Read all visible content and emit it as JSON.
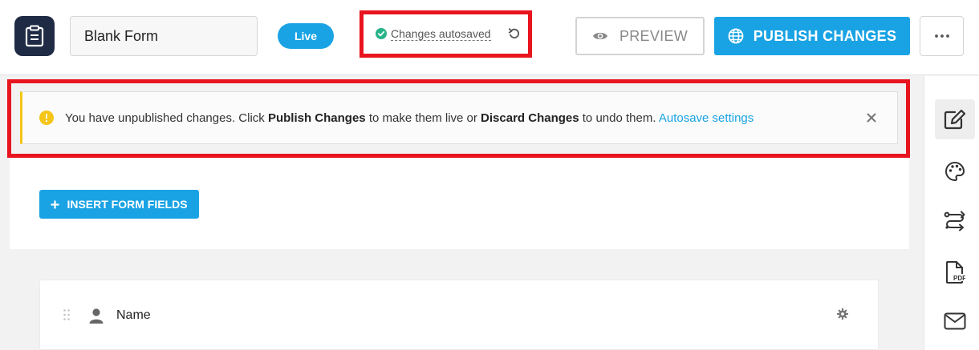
{
  "header": {
    "form_name": "Blank Form",
    "status_badge": "Live",
    "autosave_text": "Changes autosaved",
    "preview_label": "PREVIEW",
    "publish_label": "PUBLISH CHANGES"
  },
  "notice": {
    "text_1": "You have unpublished changes. Click ",
    "publish_bold": "Publish Changes",
    "text_2": " to make them live or ",
    "discard_bold": "Discard Changes",
    "text_3": " to undo them. ",
    "autosave_link": "Autosave settings"
  },
  "canvas": {
    "insert_label": "INSERT FORM FIELDS",
    "fields": [
      {
        "label": "Name",
        "icon": "user-icon"
      }
    ]
  },
  "sidebar": {
    "items": [
      {
        "icon": "edit-icon",
        "active": true
      },
      {
        "icon": "palette-icon",
        "active": false
      },
      {
        "icon": "routing-icon",
        "active": false
      },
      {
        "icon": "pdf-icon",
        "active": false
      },
      {
        "icon": "mail-icon",
        "active": false
      }
    ]
  },
  "colors": {
    "accent": "#1aa3e4",
    "highlight": "#e8141e",
    "app_icon_bg": "#1f2a44",
    "notice_accent": "#f5c518",
    "success": "#27b38a"
  }
}
